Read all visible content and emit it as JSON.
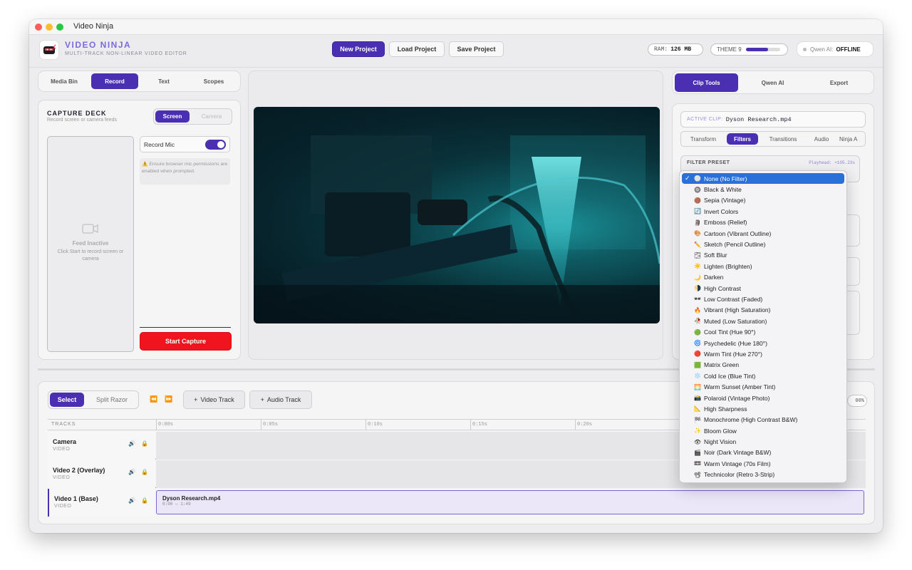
{
  "window": {
    "title": "Video Ninja"
  },
  "header": {
    "app_name": "VIDEO NINJA",
    "subtitle": "MULTI-TRACK NON-LINEAR VIDEO EDITOR",
    "new_project": "New Project",
    "load_project": "Load Project",
    "save_project": "Save Project",
    "ram_label": "RAM:",
    "ram_value": "126 MB",
    "theme_label": "THEME 9",
    "theme_progress": 0.65,
    "ai_label": "Qwen AI:",
    "ai_status": "OFFLINE"
  },
  "left_tabs": [
    "Media Bin",
    "Record",
    "Text",
    "Scopes"
  ],
  "capture": {
    "title": "CAPTURE DECK",
    "subtitle": "Record screen or camera feeds",
    "modes": [
      "Screen",
      "Camera"
    ],
    "record_mic": "Record Mic",
    "mic_on": true,
    "notice": "Ensure browser mic permissions are enabled when prompted.",
    "feed_title": "Feed Inactive",
    "feed_sub": "Click Start to record screen or camera",
    "start": "Start Capture"
  },
  "right_tabs": [
    "Clip Tools",
    "Qwen AI",
    "Export"
  ],
  "clip": {
    "active_label": "ACTIVE CLIP:",
    "active_name": "Dyson Research.mp4",
    "subtabs": [
      "Transform",
      "Filters",
      "Transitions",
      "Audio",
      "Ninja A"
    ],
    "filter_preset_label": "FILTER PRESET",
    "playhead": "Playhead: +105.23s"
  },
  "filters": [
    {
      "icon": "⚪",
      "label": "None (No Filter)",
      "selected": true
    },
    {
      "icon": "🔘",
      "label": "Black & White"
    },
    {
      "icon": "🟤",
      "label": "Sepia (Vintage)"
    },
    {
      "icon": "🔄",
      "label": "Invert Colors"
    },
    {
      "icon": "🗿",
      "label": "Emboss (Relief)"
    },
    {
      "icon": "🎨",
      "label": "Cartoon (Vibrant Outline)"
    },
    {
      "icon": "✏️",
      "label": "Sketch (Pencil Outline)"
    },
    {
      "icon": "🌫",
      "label": "Soft Blur"
    },
    {
      "icon": "☀️",
      "label": "Lighten (Brighten)"
    },
    {
      "icon": "🌙",
      "label": "Darken"
    },
    {
      "icon": "🌗",
      "label": "High Contrast"
    },
    {
      "icon": "🕶",
      "label": "Low Contrast (Faded)"
    },
    {
      "icon": "🔥",
      "label": "Vibrant (High Saturation)"
    },
    {
      "icon": "🥀",
      "label": "Muted (Low Saturation)"
    },
    {
      "icon": "🟢",
      "label": "Cool Tint (Hue 90°)"
    },
    {
      "icon": "🌀",
      "label": "Psychedelic (Hue 180°)"
    },
    {
      "icon": "🔴",
      "label": "Warm Tint (Hue 270°)"
    },
    {
      "icon": "🟩",
      "label": "Matrix Green"
    },
    {
      "icon": "❄️",
      "label": "Cold Ice (Blue Tint)"
    },
    {
      "icon": "🌅",
      "label": "Warm Sunset (Amber Tint)"
    },
    {
      "icon": "📸",
      "label": "Polaroid (Vintage Photo)"
    },
    {
      "icon": "📐",
      "label": "High Sharpness"
    },
    {
      "icon": "🏁",
      "label": "Monochrome (High Contrast B&W)"
    },
    {
      "icon": "✨",
      "label": "Bloom Glow"
    },
    {
      "icon": "👁",
      "label": "Night Vision"
    },
    {
      "icon": "🎬",
      "label": "Noir (Dark Vintage B&W)"
    },
    {
      "icon": "📼",
      "label": "Warm Vintage (70s Film)"
    },
    {
      "icon": "📽",
      "label": "Technicolor (Retro 3-Strip)"
    }
  ],
  "timeline": {
    "select": "Select",
    "razor": "Split Razor",
    "video_track": "Video Track",
    "audio_track": "Audio Track",
    "zoom": "00%",
    "tracks_label": "TRACKS",
    "ticks": [
      "0:00s",
      "0:05s",
      "0:10s",
      "0:15s",
      "0:20s"
    ],
    "tracks": [
      {
        "name": "Camera",
        "type": "VIDEO"
      },
      {
        "name": "Video 2 (Overlay)",
        "type": "VIDEO"
      },
      {
        "name": "Video 1 (Base)",
        "type": "VIDEO"
      }
    ],
    "clip_name": "Dyson Research.mp4",
    "clip_time": "0:00 — 1:49"
  },
  "colors": {
    "accent": "#4a2fb3",
    "danger": "#f0141e",
    "select": "#2b6fd8"
  }
}
